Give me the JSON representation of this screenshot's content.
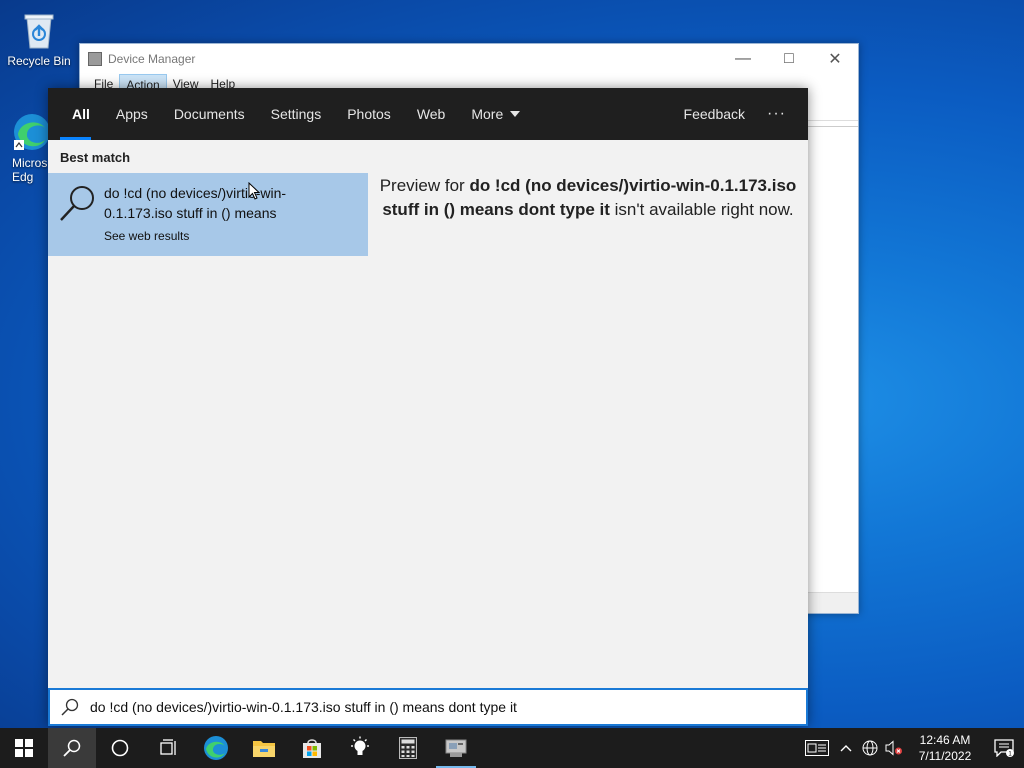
{
  "desktop": {
    "icons": [
      {
        "label": "Recycle Bin"
      },
      {
        "label": "Micros Edg"
      }
    ]
  },
  "device_manager": {
    "title": "Device Manager",
    "menu": [
      "File",
      "Action",
      "View",
      "Help"
    ]
  },
  "search": {
    "tabs": [
      {
        "label": "All"
      },
      {
        "label": "Apps"
      },
      {
        "label": "Documents"
      },
      {
        "label": "Settings"
      },
      {
        "label": "Photos"
      },
      {
        "label": "Web"
      },
      {
        "label": "More"
      }
    ],
    "feedback_label": "Feedback",
    "overflow_label": "···",
    "best_match_label": "Best match",
    "result": {
      "title": "do !cd (no devices/)virtio-win-0.1.173.iso stuff in () means",
      "subtitle": "See web results"
    },
    "preview": {
      "prefix": "Preview for ",
      "query": "do !cd (no devices/)virtio-win-0.1.173.iso stuff in () means dont type it",
      "suffix": " isn't available right now."
    },
    "query_value": "do !cd (no devices/)virtio-win-0.1.173.iso stuff in () means dont type it"
  },
  "taskbar": {
    "icons": [
      "windows-start-icon",
      "search-icon",
      "cortana-icon",
      "task-view-icon",
      "edge-icon",
      "file-explorer-icon",
      "store-icon",
      "tips-icon",
      "calculator-icon",
      "device-manager-icon"
    ],
    "clock": {
      "time": "12:46 AM",
      "date": "7/11/2022"
    }
  },
  "colors": {
    "accent": "#0a84ff",
    "selection": "#a7c8e8",
    "taskbar": "#1c1c1c"
  }
}
